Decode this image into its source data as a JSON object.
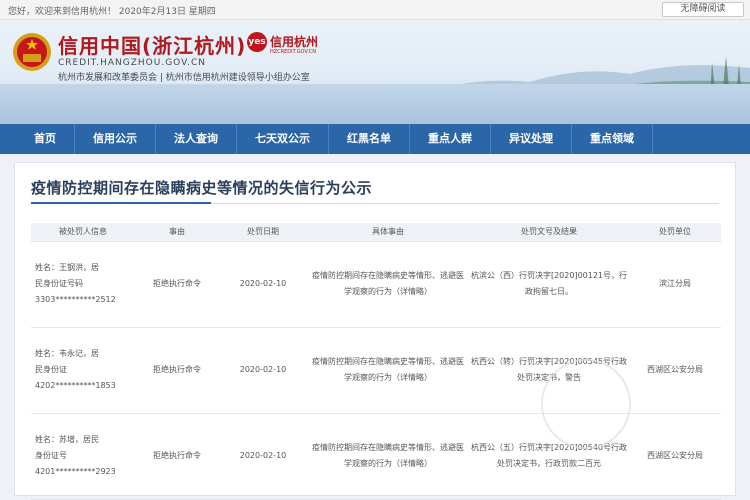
{
  "topbar": {
    "greeting": "您好，欢迎来到信用杭州！  2020年2月13日 星期四",
    "accessibility_button": "无障碍阅读"
  },
  "header": {
    "site_title": "信用中国(浙江杭州)",
    "domain": "CREDIT.HANGZHOU.GOV.CN",
    "org_line": "杭州市发展和改革委员会 | 杭州市信用杭州建设领导小组办公室",
    "badge_text": "信用杭州",
    "badge_sub": "HZCREDIT.GOV.CN",
    "badge_mark": "yes"
  },
  "nav": {
    "items": [
      "首页",
      "信用公示",
      "法人查询",
      "七天双公示",
      "红黑名单",
      "重点人群",
      "异议处理",
      "重点领域"
    ]
  },
  "page": {
    "title": "疫情防控期间存在隐瞒病史等情况的失信行为公示"
  },
  "table": {
    "headers": [
      "被处罚人信息",
      "事由",
      "处罚日期",
      "具体事由",
      "处罚文号及结果",
      "处罚单位"
    ],
    "rows": [
      {
        "person_name": "姓名：王钢洪，居",
        "person_id_label": "民身份证号码",
        "person_id": "3303**********2512",
        "reason": "拒绝执行命令",
        "date": "2020-02-10",
        "detail_line1": "疫情防控期间存在隐瞒病史等情形、逃避医",
        "detail_line2": "学观察的行为",
        "detail_link": "（详情略）",
        "result_line1": "杭滨公（西）行罚决字[2020]00121号，行",
        "result_line2": "政拘留七日。",
        "unit": "滨江分局"
      },
      {
        "person_name": "姓名：韦永记，居",
        "person_id_label": "民身份证",
        "person_id": "4202**********1853",
        "reason": "拒绝执行命令",
        "date": "2020-02-10",
        "detail_line1": "疫情防控期间存在隐瞒病史等情形、逃避医",
        "detail_line2": "学观察的行为",
        "detail_link": "（详情略）",
        "result_line1": "杭西公（转）行罚决字[2020]00545号行政",
        "result_line2": "处罚决定书，警告",
        "unit": "西湖区公安分局"
      },
      {
        "person_name": "姓名：苏增，居民",
        "person_id_label": "身份证号",
        "person_id": "4201**********2923",
        "reason": "拒绝执行命令",
        "date": "2020-02-10",
        "detail_line1": "疫情防控期间存在隐瞒病史等情形、逃避医",
        "detail_line2": "学观察的行为",
        "detail_link": "（详情略）",
        "result_line1": "杭西公（五）行罚决字[2020]00540号行政",
        "result_line2": "处罚决定书，行政罚款二百元",
        "unit": "西湖区公安分局"
      }
    ]
  },
  "colors": {
    "nav_bg": "#2b66a8",
    "brand_red": "#b0191e"
  }
}
